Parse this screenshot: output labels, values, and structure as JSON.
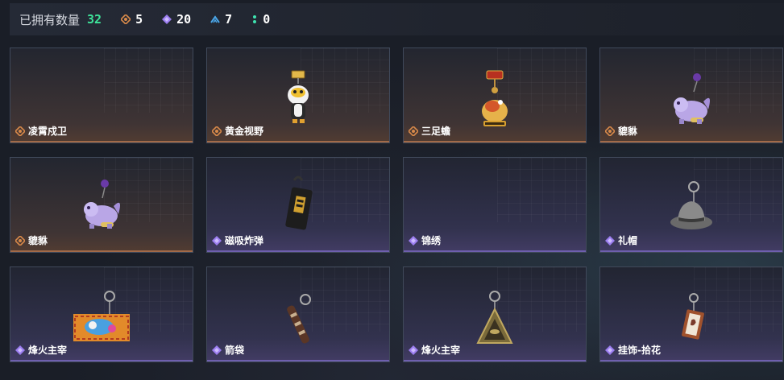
{
  "header": {
    "label": "已拥有数量",
    "total": "32",
    "stats": [
      {
        "icon": "orange-diamond-icon",
        "color": "#d98a4a",
        "value": "5"
      },
      {
        "icon": "purple-diamond-icon",
        "color": "#9c7ef0",
        "value": "20"
      },
      {
        "icon": "blue-chevron-icon",
        "color": "#4aa6e8",
        "value": "7"
      },
      {
        "icon": "green-dots-icon",
        "color": "#3ee3b0",
        "value": "0"
      }
    ]
  },
  "colors": {
    "orange_rarity": "#d98a4a",
    "purple_rarity": "#9c7ef0",
    "total_green": "#3ee39a"
  },
  "items": [
    {
      "name": "凌霄戍卫",
      "rarity": "orange",
      "art": "empty"
    },
    {
      "name": "黄金视野",
      "rarity": "orange",
      "art": "penguin-keychain"
    },
    {
      "name": "三足蟾",
      "rarity": "orange",
      "art": "toad-keychain"
    },
    {
      "name": "貔貅",
      "rarity": "orange",
      "art": "pixiu-keychain"
    },
    {
      "name": "貔貅",
      "rarity": "orange",
      "art": "pixiu-keychain"
    },
    {
      "name": "磁吸炸弹",
      "rarity": "purple",
      "art": "bomb-keychain"
    },
    {
      "name": "锦绣",
      "rarity": "purple",
      "art": "empty"
    },
    {
      "name": "礼帽",
      "rarity": "purple",
      "art": "hat-keychain"
    },
    {
      "name": "烽火主宰",
      "rarity": "purple",
      "art": "banner-keychain"
    },
    {
      "name": "箭袋",
      "rarity": "purple",
      "art": "quiver-keychain"
    },
    {
      "name": "烽火主宰",
      "rarity": "purple",
      "art": "pyramid-keychain"
    },
    {
      "name": "挂饰-拾花",
      "rarity": "purple",
      "art": "frame-keychain"
    }
  ]
}
